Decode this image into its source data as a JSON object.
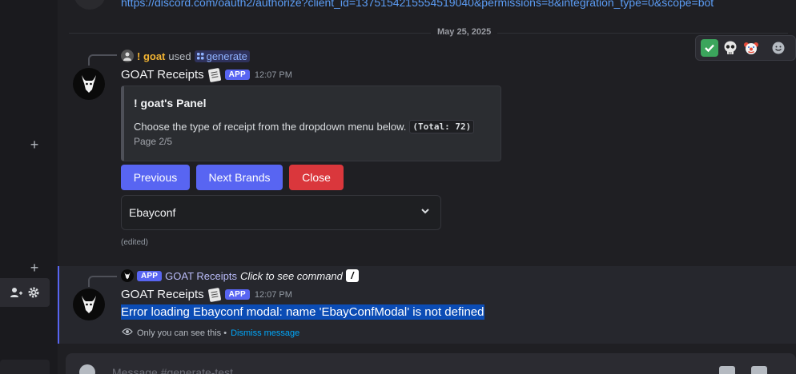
{
  "top": {
    "link": "https://discord.com/oauth2/authorize?client_id=1375154215554519040&permissions=8&integration_type=0&scope=bot"
  },
  "divider": {
    "date": "May 25, 2025"
  },
  "reactions": [
    "white-check-mark",
    "skull",
    "clown-face",
    "add-reaction"
  ],
  "message1": {
    "reply": {
      "user": "! goat",
      "used": "used",
      "command": "generate"
    },
    "author": "GOAT Receipts",
    "badge": "APP",
    "time": "12:07 PM",
    "embed": {
      "title": "! goat's Panel",
      "description": "Choose the type of receipt from the dropdown menu below.",
      "total": "(Total: 72)",
      "footer": "Page 2/5"
    },
    "buttons": {
      "previous": "Previous",
      "next": "Next Brands",
      "close": "Close"
    },
    "select": {
      "value": "Ebayconf"
    },
    "edited": "(edited)"
  },
  "message2": {
    "reply": {
      "badge": "APP",
      "author": "GOAT Receipts",
      "command_hint": "Click to see command",
      "slash": "/"
    },
    "author": "GOAT Receipts",
    "badge": "APP",
    "time": "12:07 PM",
    "error": "Error loading Ebayconf modal: name 'EbayConfModal' is not defined",
    "only_you": "Only you can see this •",
    "dismiss": "Dismiss message"
  },
  "composer": {
    "placeholder": "Message #generate-test"
  },
  "colors": {
    "accent": "#5865f2",
    "danger": "#da373c",
    "selection": "#0b4cb5",
    "link": "#5c9df5"
  }
}
